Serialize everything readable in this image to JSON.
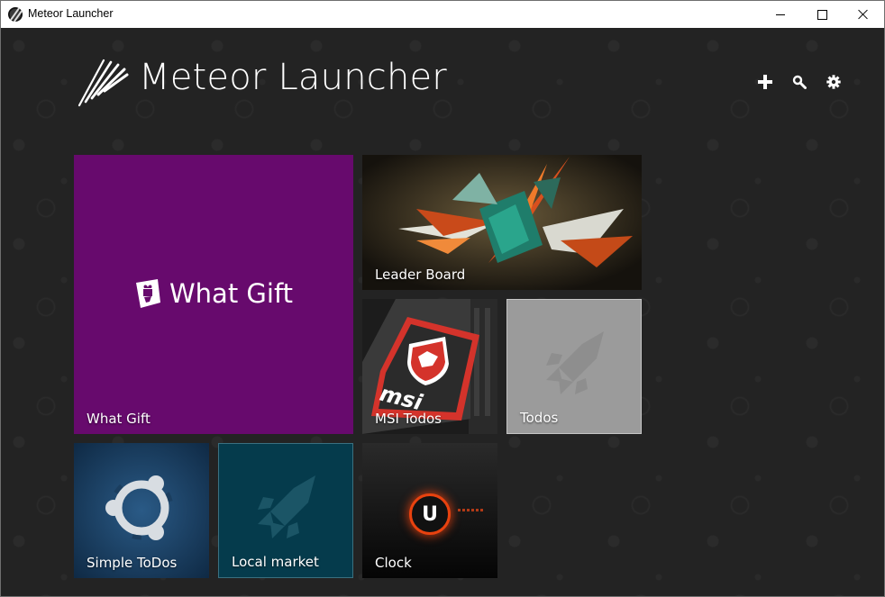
{
  "window": {
    "title": "Meteor Launcher"
  },
  "header": {
    "title": "Meteor Launcher",
    "actions": [
      {
        "name": "add",
        "icon": "plus-icon"
      },
      {
        "name": "search",
        "icon": "search-icon"
      },
      {
        "name": "settings",
        "icon": "gear-icon"
      }
    ]
  },
  "tiles": [
    {
      "label": "What Gift",
      "brand": "What Gift",
      "color": "#670a6d"
    },
    {
      "label": "Leader Board",
      "color": "#1d1a14"
    },
    {
      "label": "MSI Todos",
      "color": "#222222"
    },
    {
      "label": "Todos",
      "color": "#9b9b9b"
    },
    {
      "label": "Simple ToDos",
      "color": "#1b3e5f"
    },
    {
      "label": "Local market",
      "color": "#053b4c"
    },
    {
      "label": "Clock",
      "color": "#111111",
      "badge_letter": "U"
    }
  ]
}
